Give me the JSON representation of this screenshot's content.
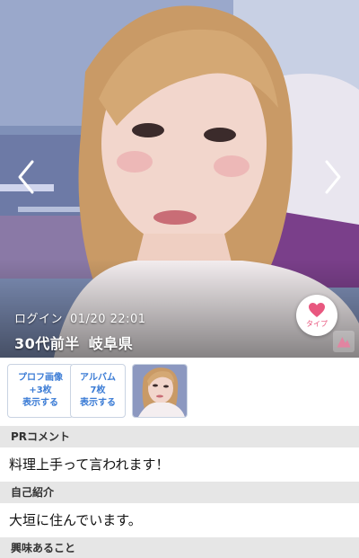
{
  "hero": {
    "login_label": "ログイン",
    "login_datetime": "01/20 22:01",
    "age": "30代前半",
    "prefecture": "岐阜県",
    "like_label": "タイプ",
    "prev_icon": "chevron-left-icon",
    "next_icon": "chevron-right-icon",
    "like_icon": "heart-icon",
    "accent_color": "#e8577f"
  },
  "buttons": {
    "profile_images": "プロフ画像\n+3枚\n表示する",
    "album": "アルバム\n7枚\n表示する"
  },
  "sections": [
    {
      "heading": "PRコメント",
      "body": "料理上手って言われます！"
    },
    {
      "heading": "自己紹介",
      "body": "大垣に住んでいます。"
    },
    {
      "heading": "興味あること",
      "body": ""
    }
  ]
}
